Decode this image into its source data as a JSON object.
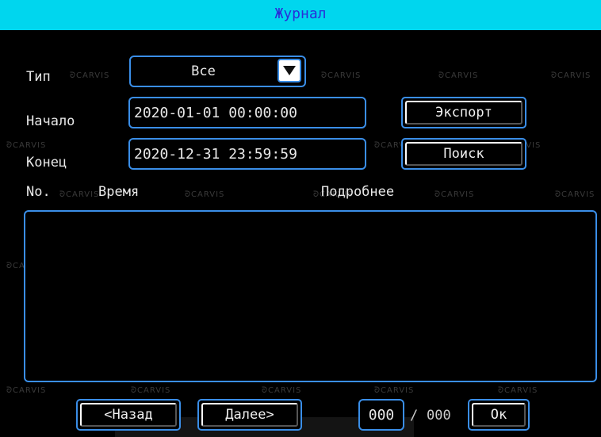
{
  "window": {
    "title": "Журнал"
  },
  "filters": {
    "type_label": "Тип",
    "type_value": "Все",
    "start_label": "Начало",
    "start_value": "2020-01-01 00:00:00",
    "end_label": "Конец",
    "end_value": "2020-12-31 23:59:59"
  },
  "actions": {
    "export_label": "Экспорт",
    "search_label": "Поиск"
  },
  "table": {
    "columns": [
      "No.",
      "Время",
      "Подробнее"
    ]
  },
  "pager": {
    "prev_label": "<Назад",
    "next_label": "Далее>",
    "current_page": "000",
    "separator": "/",
    "total_pages": "000",
    "ok_label": "Ок"
  },
  "watermark": "CARVIS",
  "colors": {
    "title_bar": "#00d6ee",
    "title_text": "#2a2cd8",
    "border_accent": "#3a8ee8",
    "background": "#000000"
  }
}
